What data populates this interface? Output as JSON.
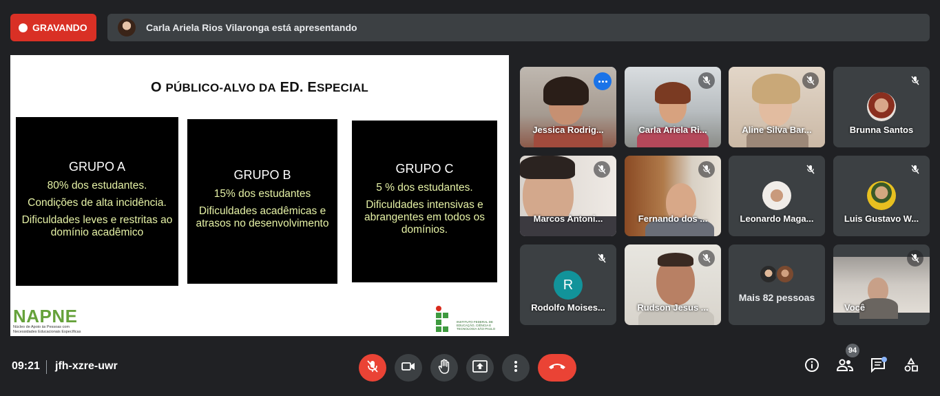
{
  "recording": {
    "label": "GRAVANDO"
  },
  "presenter_bar": {
    "text": "Carla Ariela Rios Vilaronga está apresentando"
  },
  "slide": {
    "title_first": "O",
    "title_rest": "PÚBLICO-ALVO DA",
    "title_ed": "ED.",
    "title_esp_e": "E",
    "title_esp_rest": "SPECIAL",
    "groups": [
      {
        "name": "GRUPO A",
        "lines": [
          "80% dos estudantes.",
          "Condições de alta incidência.",
          "Dificuldades leves e restritas ao domínio acadêmico"
        ]
      },
      {
        "name": "GRUPO B",
        "lines": [
          "15% dos estudantes",
          "Dificuldades acadêmicas e atrasos no desenvolvimento"
        ]
      },
      {
        "name": "GRUPO C",
        "lines": [
          "5 % dos estudantes.",
          "Dificuldades intensivas e abrangentes em todos os domínios."
        ]
      }
    ],
    "napne_logo": "NAPNE",
    "napne_sub": "Núcleo de Apoio às Pessoas com Necessidades Educacionais Específicas",
    "ifsp_text": "INSTITUTO FEDERAL DE EDUCAÇÃO, CIÊNCIA E TECNOLOGIA SÃO PAULO"
  },
  "participants": [
    {
      "name": "Jessica Rodrig...",
      "type": "video",
      "muted": false,
      "active": true
    },
    {
      "name": "Carla Ariela Ri...",
      "type": "video",
      "muted": true
    },
    {
      "name": "Aline Silva Bar...",
      "type": "video",
      "muted": true
    },
    {
      "name": "Brunna Santos",
      "type": "avatar",
      "muted": true
    },
    {
      "name": "Marcos Antoni...",
      "type": "video",
      "muted": true
    },
    {
      "name": "Fernando dos ...",
      "type": "video",
      "muted": true
    },
    {
      "name": "Leonardo Maga...",
      "type": "avatar",
      "muted": true
    },
    {
      "name": "Luis Gustavo W...",
      "type": "avatar",
      "muted": true
    },
    {
      "name": "Rodolfo Moises...",
      "type": "letter",
      "letter": "R",
      "muted": true
    },
    {
      "name": "Rudson Jesus ...",
      "type": "video",
      "muted": true
    },
    {
      "name": "Mais 82 pessoas",
      "type": "more"
    },
    {
      "name": "Você",
      "type": "video",
      "muted": true
    }
  ],
  "bottom": {
    "time": "09:21",
    "meeting_code": "jfh-xzre-uwr",
    "participants_count": "94",
    "icons": [
      "mic-off-icon",
      "camera-icon",
      "raise-hand-icon",
      "present-icon",
      "more-options-icon",
      "hangup-icon",
      "info-icon",
      "people-icon",
      "chat-icon",
      "activities-icon"
    ]
  },
  "colors": {
    "background": "#202124",
    "tile": "#3c4043",
    "recording": "#d93025",
    "hangup": "#ea4335",
    "accent": "#8ab4f8",
    "slide_text": "#e6f2a6"
  }
}
